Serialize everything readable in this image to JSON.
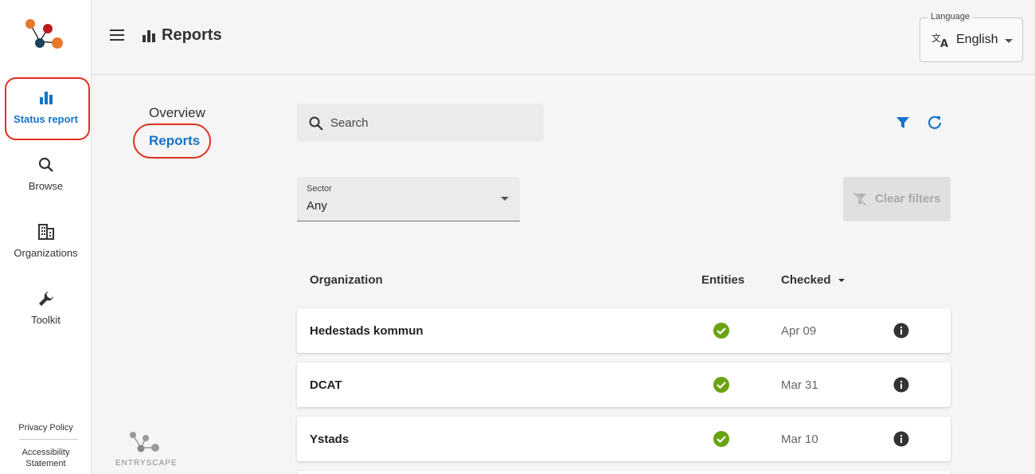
{
  "rail": {
    "items": [
      {
        "label": "Status report",
        "icon": "bar-chart-icon",
        "active": true
      },
      {
        "label": "Browse",
        "icon": "search-icon"
      },
      {
        "label": "Organizations",
        "icon": "building-icon"
      },
      {
        "label": "Toolkit",
        "icon": "wrench-icon"
      }
    ],
    "footer": {
      "privacy": "Privacy Policy",
      "accessibility_line1": "Accessibility",
      "accessibility_line2": "Statement"
    }
  },
  "header": {
    "title": "Reports",
    "language": {
      "legend": "Language",
      "value": "English"
    }
  },
  "subnav": {
    "overview": "Overview",
    "reports": "Reports"
  },
  "search": {
    "placeholder": "Search"
  },
  "filters": {
    "sector": {
      "label": "Sector",
      "value": "Any"
    },
    "clear_label": "Clear filters"
  },
  "table": {
    "columns": {
      "organization": "Organization",
      "entities": "Entities",
      "checked": "Checked"
    },
    "rows": [
      {
        "organization": "Hedestads kommun",
        "checked": "Apr 09"
      },
      {
        "organization": "DCAT",
        "checked": "Mar 31"
      },
      {
        "organization": "Ystads",
        "checked": "Mar 10"
      }
    ]
  },
  "branding": {
    "footer_logo": "ENTRYSCAPE"
  },
  "colors": {
    "accent": "#1673c7",
    "success": "#6aa312",
    "highlight": "#e0301e"
  }
}
